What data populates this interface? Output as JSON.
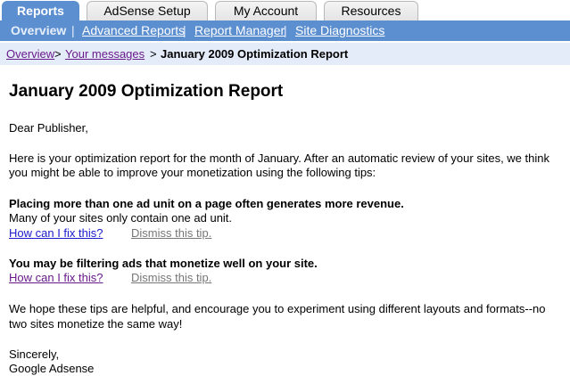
{
  "tabs": [
    {
      "label": "Reports",
      "active": true
    },
    {
      "label": "AdSense Setup",
      "active": false
    },
    {
      "label": "My Account",
      "active": false
    },
    {
      "label": "Resources",
      "active": false
    }
  ],
  "subnav": {
    "current": "Overview",
    "links": [
      "Advanced Reports",
      "Report Manager",
      "Site Diagnostics"
    ],
    "separator": "|"
  },
  "breadcrumb": {
    "items": [
      "Overview",
      "Your messages"
    ],
    "separator": ">",
    "current": "January 2009 Optimization Report"
  },
  "report": {
    "title": "January 2009 Optimization Report",
    "greeting": "Dear Publisher,",
    "intro_line1": "Here is your optimization report for the month of January. After an automatic review of your sites, we think",
    "intro_line2": "you might be able to improve your monetization using the following tips:",
    "tips": [
      {
        "heading": "Placing more than one ad unit on a page often generates more revenue.",
        "detail": "Many of your sites only contain one ad unit.",
        "fix_link": "How can I fix this?",
        "dismiss_link": "Dismiss this tip."
      },
      {
        "heading": "You may be filtering ads that monetize well on your site.",
        "fix_link": "How can I fix this?",
        "dismiss_link": "Dismiss this tip."
      }
    ],
    "closing_line1": "We hope these tips are helpful, and encourage you to experiment using different layouts and formats--no",
    "closing_line2": "two sites monetize the same way!",
    "signoff": "Sincerely,",
    "signature": "Google Adsense"
  },
  "colors": {
    "nav_blue": "#5c8fd0",
    "crumb_bg": "#e5ecf9",
    "link": "#1a1acc",
    "visited": "#681a8a",
    "muted": "#777777"
  }
}
